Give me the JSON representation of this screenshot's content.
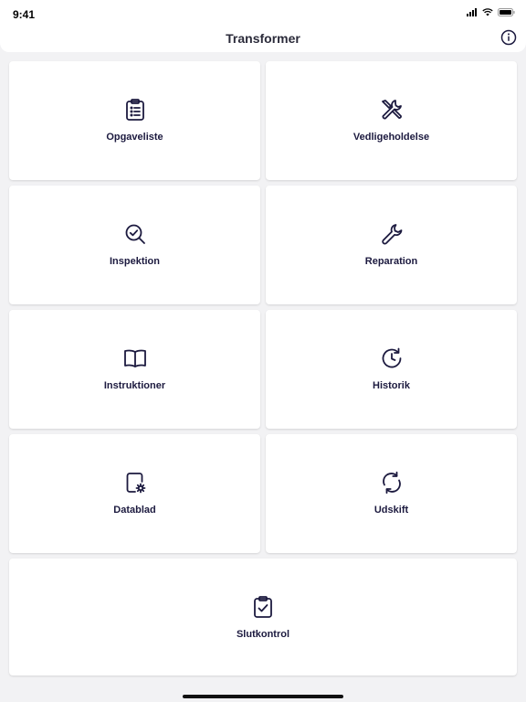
{
  "status_bar": {
    "time": "9:41"
  },
  "nav": {
    "title": "Transformer",
    "info_icon": "info-icon"
  },
  "tiles": [
    {
      "label": "Opgaveliste",
      "icon": "clipboard-list-icon"
    },
    {
      "label": "Vedligeholdelse",
      "icon": "tools-icon"
    },
    {
      "label": "Inspektion",
      "icon": "search-check-icon"
    },
    {
      "label": "Reparation",
      "icon": "wrench-icon"
    },
    {
      "label": "Instruktioner",
      "icon": "book-icon"
    },
    {
      "label": "Historik",
      "icon": "history-icon"
    },
    {
      "label": "Datablad",
      "icon": "datasheet-icon"
    },
    {
      "label": "Udskift",
      "icon": "refresh-icon"
    },
    {
      "label": "Slutkontrol",
      "icon": "clipboard-check-icon"
    }
  ],
  "colors": {
    "icon": "#1c1a3f",
    "background": "#f2f2f4",
    "tile": "#ffffff"
  }
}
